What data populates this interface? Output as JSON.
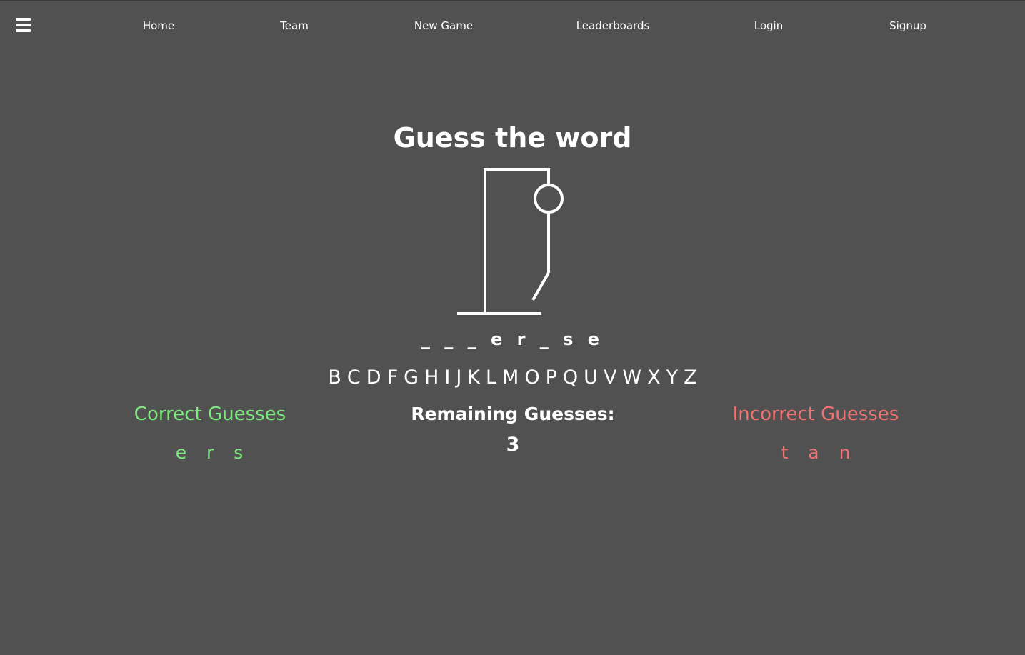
{
  "nav": {
    "items": [
      {
        "label": "Home"
      },
      {
        "label": "Team"
      },
      {
        "label": "New Game"
      },
      {
        "label": "Leaderboards"
      },
      {
        "label": "Login"
      },
      {
        "label": "Signup"
      }
    ]
  },
  "icons": {
    "menu": "hamburger-menu-icon"
  },
  "game": {
    "title": "Guess the word",
    "word_display": "_ _ _ e r _ s e",
    "available_letters": [
      "B",
      "C",
      "D",
      "F",
      "G",
      "H",
      "I",
      "J",
      "K",
      "L",
      "M",
      "O",
      "P",
      "Q",
      "U",
      "V",
      "W",
      "X",
      "Y",
      "Z"
    ],
    "correct_title": "Correct Guesses",
    "correct_letters": "e r s",
    "remaining_title": "Remaining Guesses:",
    "remaining_count": "3",
    "incorrect_title": "Incorrect Guesses",
    "incorrect_letters": "t a n"
  },
  "colors": {
    "background": "#515151",
    "correct": "#7cea7c",
    "incorrect": "#f07272",
    "text": "#ffffff"
  }
}
